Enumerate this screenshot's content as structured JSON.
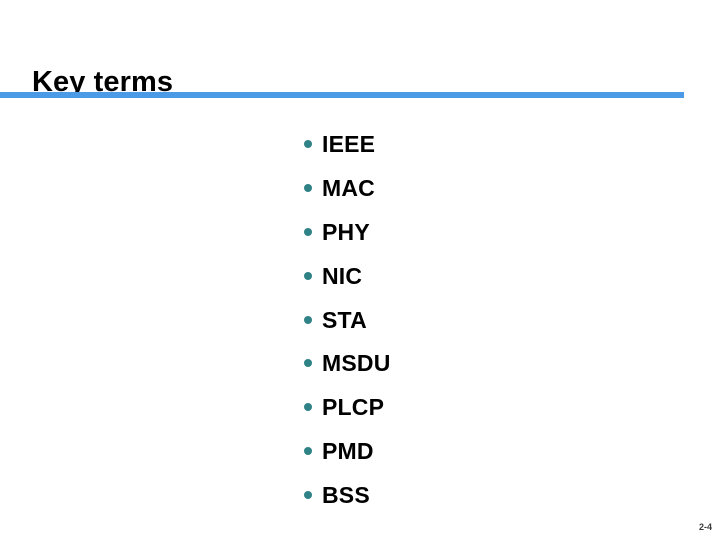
{
  "slide": {
    "title": "Key terms",
    "page_number": "2-4",
    "colors": {
      "background": "#ffffff",
      "title_text": "#000000",
      "rule_blue": "#4a9ae8",
      "bullet_teal": "#2f8285",
      "body_text": "#000000",
      "page_number_text": "#3a3a3a"
    },
    "bullets": [
      {
        "label": "IEEE"
      },
      {
        "label": "MAC"
      },
      {
        "label": "PHY"
      },
      {
        "label": "NIC"
      },
      {
        "label": "STA"
      },
      {
        "label": "MSDU"
      },
      {
        "label": "PLCP"
      },
      {
        "label": "PMD"
      },
      {
        "label": "BSS"
      }
    ]
  }
}
